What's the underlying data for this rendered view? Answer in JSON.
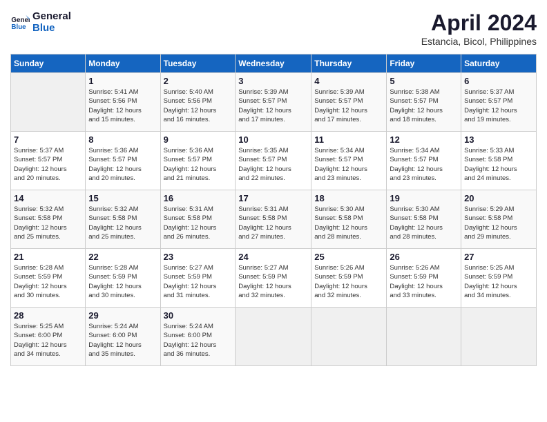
{
  "logo": {
    "name_line1": "General",
    "name_line2": "Blue"
  },
  "title": "April 2024",
  "location": "Estancia, Bicol, Philippines",
  "weekdays": [
    "Sunday",
    "Monday",
    "Tuesday",
    "Wednesday",
    "Thursday",
    "Friday",
    "Saturday"
  ],
  "days": [
    {
      "num": "",
      "sunrise": "",
      "sunset": "",
      "daylight": ""
    },
    {
      "num": "1",
      "sunrise": "5:41 AM",
      "sunset": "5:56 PM",
      "daylight": "12 hours and 15 minutes."
    },
    {
      "num": "2",
      "sunrise": "5:40 AM",
      "sunset": "5:56 PM",
      "daylight": "12 hours and 16 minutes."
    },
    {
      "num": "3",
      "sunrise": "5:39 AM",
      "sunset": "5:57 PM",
      "daylight": "12 hours and 17 minutes."
    },
    {
      "num": "4",
      "sunrise": "5:39 AM",
      "sunset": "5:57 PM",
      "daylight": "12 hours and 17 minutes."
    },
    {
      "num": "5",
      "sunrise": "5:38 AM",
      "sunset": "5:57 PM",
      "daylight": "12 hours and 18 minutes."
    },
    {
      "num": "6",
      "sunrise": "5:37 AM",
      "sunset": "5:57 PM",
      "daylight": "12 hours and 19 minutes."
    },
    {
      "num": "7",
      "sunrise": "5:37 AM",
      "sunset": "5:57 PM",
      "daylight": "12 hours and 20 minutes."
    },
    {
      "num": "8",
      "sunrise": "5:36 AM",
      "sunset": "5:57 PM",
      "daylight": "12 hours and 20 minutes."
    },
    {
      "num": "9",
      "sunrise": "5:36 AM",
      "sunset": "5:57 PM",
      "daylight": "12 hours and 21 minutes."
    },
    {
      "num": "10",
      "sunrise": "5:35 AM",
      "sunset": "5:57 PM",
      "daylight": "12 hours and 22 minutes."
    },
    {
      "num": "11",
      "sunrise": "5:34 AM",
      "sunset": "5:57 PM",
      "daylight": "12 hours and 23 minutes."
    },
    {
      "num": "12",
      "sunrise": "5:34 AM",
      "sunset": "5:57 PM",
      "daylight": "12 hours and 23 minutes."
    },
    {
      "num": "13",
      "sunrise": "5:33 AM",
      "sunset": "5:58 PM",
      "daylight": "12 hours and 24 minutes."
    },
    {
      "num": "14",
      "sunrise": "5:32 AM",
      "sunset": "5:58 PM",
      "daylight": "12 hours and 25 minutes."
    },
    {
      "num": "15",
      "sunrise": "5:32 AM",
      "sunset": "5:58 PM",
      "daylight": "12 hours and 25 minutes."
    },
    {
      "num": "16",
      "sunrise": "5:31 AM",
      "sunset": "5:58 PM",
      "daylight": "12 hours and 26 minutes."
    },
    {
      "num": "17",
      "sunrise": "5:31 AM",
      "sunset": "5:58 PM",
      "daylight": "12 hours and 27 minutes."
    },
    {
      "num": "18",
      "sunrise": "5:30 AM",
      "sunset": "5:58 PM",
      "daylight": "12 hours and 28 minutes."
    },
    {
      "num": "19",
      "sunrise": "5:30 AM",
      "sunset": "5:58 PM",
      "daylight": "12 hours and 28 minutes."
    },
    {
      "num": "20",
      "sunrise": "5:29 AM",
      "sunset": "5:58 PM",
      "daylight": "12 hours and 29 minutes."
    },
    {
      "num": "21",
      "sunrise": "5:28 AM",
      "sunset": "5:59 PM",
      "daylight": "12 hours and 30 minutes."
    },
    {
      "num": "22",
      "sunrise": "5:28 AM",
      "sunset": "5:59 PM",
      "daylight": "12 hours and 30 minutes."
    },
    {
      "num": "23",
      "sunrise": "5:27 AM",
      "sunset": "5:59 PM",
      "daylight": "12 hours and 31 minutes."
    },
    {
      "num": "24",
      "sunrise": "5:27 AM",
      "sunset": "5:59 PM",
      "daylight": "12 hours and 32 minutes."
    },
    {
      "num": "25",
      "sunrise": "5:26 AM",
      "sunset": "5:59 PM",
      "daylight": "12 hours and 32 minutes."
    },
    {
      "num": "26",
      "sunrise": "5:26 AM",
      "sunset": "5:59 PM",
      "daylight": "12 hours and 33 minutes."
    },
    {
      "num": "27",
      "sunrise": "5:25 AM",
      "sunset": "5:59 PM",
      "daylight": "12 hours and 34 minutes."
    },
    {
      "num": "28",
      "sunrise": "5:25 AM",
      "sunset": "6:00 PM",
      "daylight": "12 hours and 34 minutes."
    },
    {
      "num": "29",
      "sunrise": "5:24 AM",
      "sunset": "6:00 PM",
      "daylight": "12 hours and 35 minutes."
    },
    {
      "num": "30",
      "sunrise": "5:24 AM",
      "sunset": "6:00 PM",
      "daylight": "12 hours and 36 minutes."
    },
    {
      "num": "",
      "sunrise": "",
      "sunset": "",
      "daylight": ""
    },
    {
      "num": "",
      "sunrise": "",
      "sunset": "",
      "daylight": ""
    },
    {
      "num": "",
      "sunrise": "",
      "sunset": "",
      "daylight": ""
    },
    {
      "num": "",
      "sunrise": "",
      "sunset": "",
      "daylight": ""
    }
  ],
  "labels": {
    "sunrise": "Sunrise:",
    "sunset": "Sunset:",
    "daylight": "Daylight:"
  }
}
